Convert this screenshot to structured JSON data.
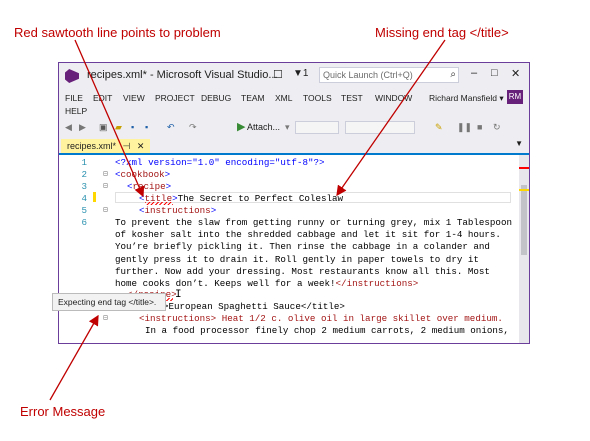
{
  "callouts": {
    "sawtooth": "Red sawtooth line points to problem",
    "missing": "Missing end tag </title>",
    "error": "Error Message"
  },
  "window": {
    "title": "recipes.xml* - Microsoft Visual Studio...",
    "notify_count": "1",
    "quick_launch_placeholder": "Quick Launch (Ctrl+Q)"
  },
  "menu": {
    "items": [
      "FILE",
      "EDIT",
      "VIEW",
      "PROJECT",
      "DEBUG",
      "TEAM",
      "XML",
      "TOOLS",
      "TEST",
      "WINDOW",
      "HELP"
    ],
    "user": "Richard Mansfield",
    "avatar": "RM"
  },
  "toolbar": {
    "attach_label": "Attach..."
  },
  "tabs": [
    {
      "label": "recipes.xml*"
    }
  ],
  "editor": {
    "line_numbers": [
      "1",
      "2",
      "3",
      "4",
      "5",
      "6"
    ],
    "line1": {
      "decl": "<?xml version=\"1.0\" encoding=\"utf-8\"?>"
    },
    "line2": {
      "open": "<",
      "name": "cookbook",
      "close": ">"
    },
    "line3": {
      "open": "<",
      "name": "recipe",
      "close": ">"
    },
    "line4": {
      "open": "<",
      "name": "title",
      "close": ">",
      "text": "The Secret to Perfect Coleslaw"
    },
    "line5": {
      "open": "<",
      "name": "instructions",
      "close": ">"
    },
    "paragraph": "To prevent the slaw from getting runny or turning grey, mix 1 Tablespoon of kosher salt into the shredded cabbage and let it sit for 1-4 hours. You’re briefly pickling it. Then rinse the cabbage in a colander and gently press it to drain it. Roll gently in paper towels to dry it further. Now add your dressing. Most restaurants know all this. Most home cooks don’t. Keeps well for a week!",
    "paragraph_end_tag": "</instructions>",
    "recipe_close": "</recipe>",
    "title2_tail": ">European Spaghetti Sauce</title>",
    "instr2": "<instructions> Heat 1/2 c. olive oil in large skillet over medium.",
    "instr2_cont": "In a food processor finely chop 2 medium carrots, 2 medium onions,"
  },
  "tooltip": {
    "text": "Expecting end tag </title>."
  },
  "colors": {
    "accent": "#007acc",
    "error": "#c00000",
    "vs_purple": "#68217a",
    "tab_active": "#fff3a0"
  }
}
